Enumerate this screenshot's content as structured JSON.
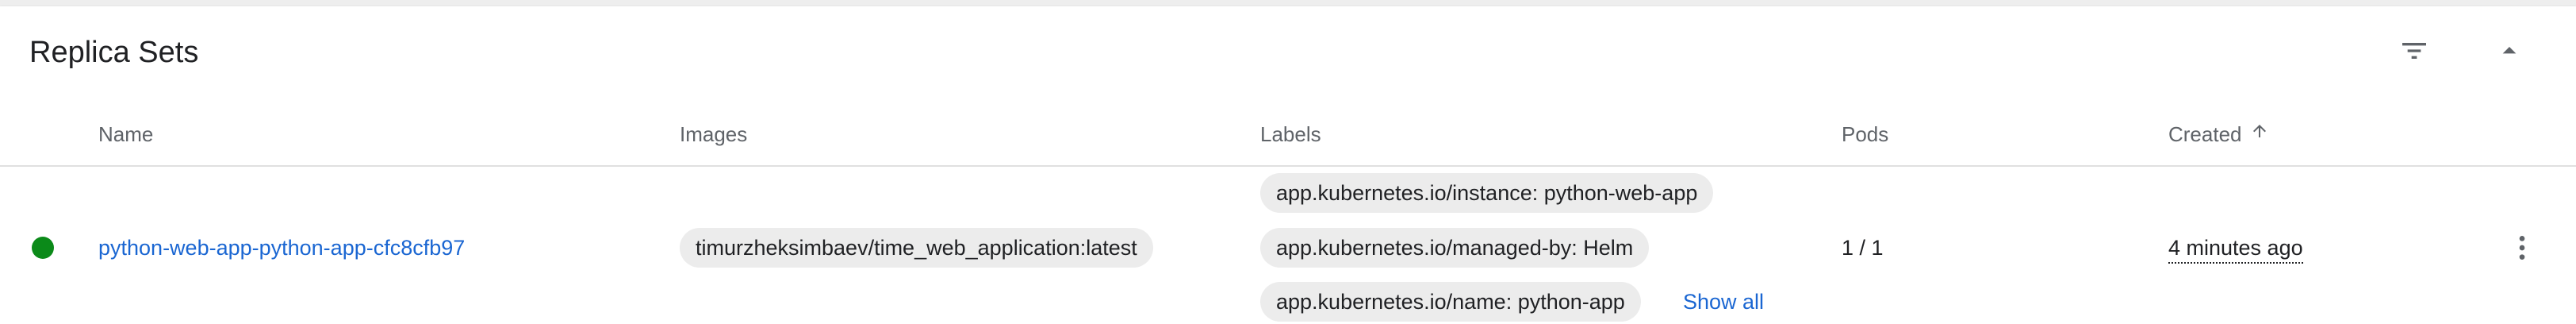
{
  "card": {
    "title": "Replica Sets",
    "actions": {
      "filter_icon": "filter-list-icon",
      "collapse_icon": "arrow-drop-up-icon"
    }
  },
  "table": {
    "columns": {
      "name": "Name",
      "images": "Images",
      "labels": "Labels",
      "pods": "Pods",
      "created": "Created"
    },
    "sort": {
      "column": "created",
      "direction": "ascending",
      "icon": "arrow-upward-icon"
    },
    "rows": [
      {
        "status": "running",
        "status_color": "#0b8a19",
        "name": "python-web-app-python-app-cfc8cfb97",
        "image": "timurzheksimbaev/time_web_application:latest",
        "labels": [
          "app.kubernetes.io/instance: python-web-app",
          "app.kubernetes.io/managed-by: Helm",
          "app.kubernetes.io/name: python-app"
        ],
        "show_all": "Show all",
        "pods": "1 / 1",
        "created": "4 minutes ago",
        "menu_icon": "more-vert-icon"
      }
    ]
  },
  "colors": {
    "link": "#1a66d2",
    "chip_bg": "#ececec",
    "header_text": "#5f6368"
  }
}
